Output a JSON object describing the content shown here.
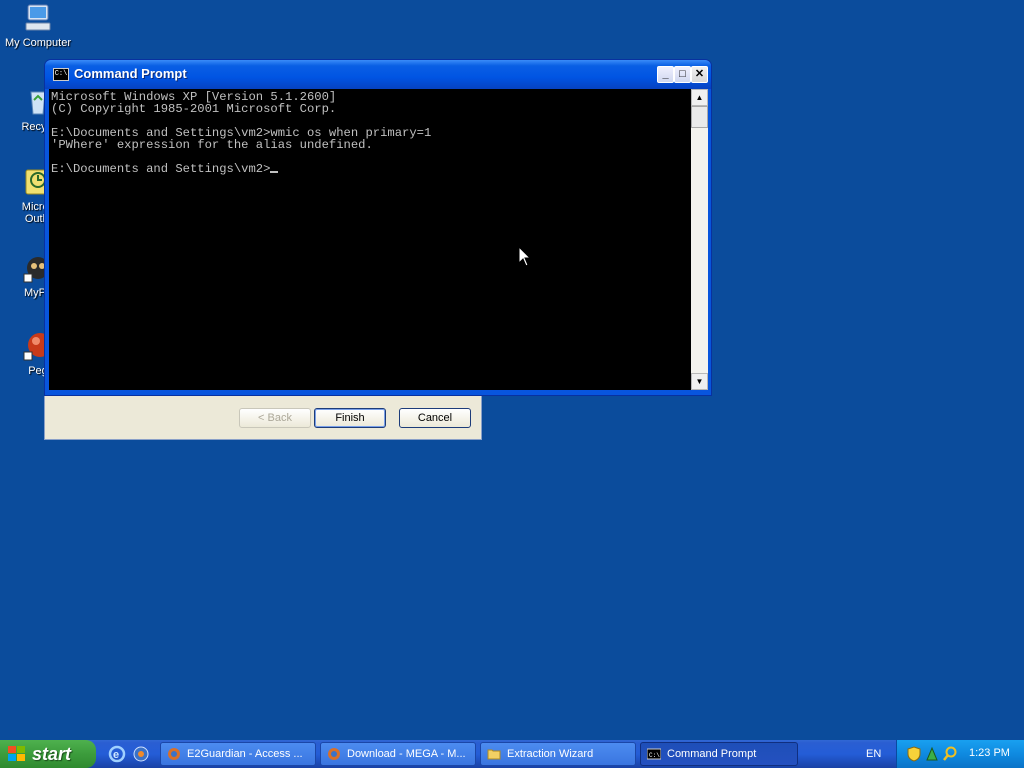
{
  "desktop": {
    "icons": [
      {
        "label": "My Computer",
        "icon": "my-computer-icon"
      },
      {
        "label": "Recycl",
        "icon": "recycle-bin-icon"
      },
      {
        "label": "Micros\nOutlo",
        "icon": "outlook-icon"
      },
      {
        "label": "MyPa",
        "icon": "mypal-icon"
      },
      {
        "label": "Peg",
        "icon": "pegasus-icon"
      }
    ]
  },
  "cmd": {
    "title": "Command Prompt",
    "icon_text": "C:\\",
    "buttons": {
      "minimize": "_",
      "maximize": "□",
      "close": "✕"
    },
    "lines": "Microsoft Windows XP [Version 5.1.2600]\n(C) Copyright 1985-2001 Microsoft Corp.\n\nE:\\Documents and Settings\\vm2>wmic os when primary=1\n'PWhere' expression for the alias undefined.\n\nE:\\Documents and Settings\\vm2>",
    "scroll_up": "▲",
    "scroll_down": "▼"
  },
  "wizard": {
    "back": "< Back",
    "finish": "Finish",
    "cancel": "Cancel"
  },
  "taskbar": {
    "start": "start",
    "tasks": [
      {
        "label": "E2Guardian - Access ...",
        "icon": "firefox-icon"
      },
      {
        "label": "Download - MEGA - M...",
        "icon": "firefox-icon"
      },
      {
        "label": "Extraction Wizard",
        "icon": "folder-icon"
      },
      {
        "label": "Command Prompt",
        "icon": "cmd-icon"
      }
    ],
    "lang": "EN",
    "clock": "1:23 PM"
  },
  "colors": {
    "desktop": "#0b4c9c",
    "console_bg": "#000000",
    "console_fg": "#c0c0c0",
    "titlebar": "#0054e3",
    "start_green": "#3c9c3c"
  }
}
